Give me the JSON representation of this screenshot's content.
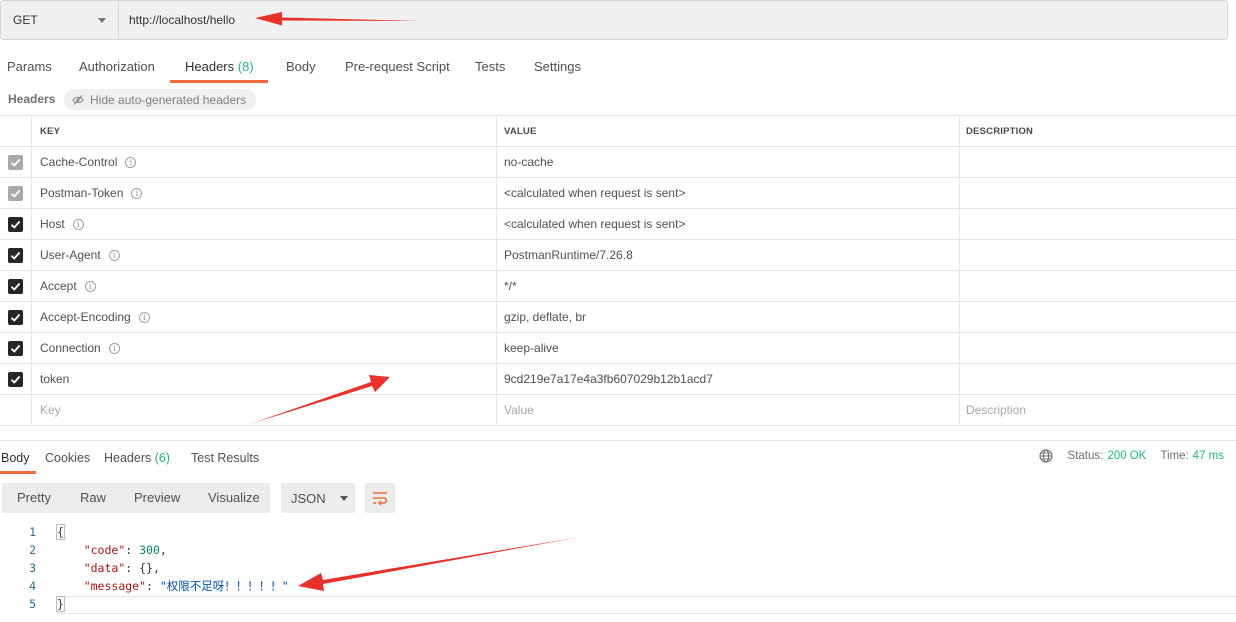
{
  "request": {
    "method": "GET",
    "url": "http://localhost/hello"
  },
  "request_tabs": [
    {
      "label": "Params",
      "count": ""
    },
    {
      "label": "Authorization",
      "count": ""
    },
    {
      "label": "Headers",
      "count": "(8)"
    },
    {
      "label": "Body",
      "count": ""
    },
    {
      "label": "Pre-request Script",
      "count": ""
    },
    {
      "label": "Tests",
      "count": ""
    },
    {
      "label": "Settings",
      "count": ""
    }
  ],
  "active_request_tab": "Headers",
  "headers_section": {
    "title": "Headers",
    "hide_button": "Hide auto-generated headers"
  },
  "headers_table": {
    "columns": {
      "key": "KEY",
      "value": "VALUE",
      "description": "DESCRIPTION"
    },
    "rows": [
      {
        "key": "Cache-Control",
        "value": "no-cache",
        "checked": "auto"
      },
      {
        "key": "Postman-Token",
        "value": "<calculated when request is sent>",
        "checked": "auto"
      },
      {
        "key": "Host",
        "value": "<calculated when request is sent>",
        "checked": "on"
      },
      {
        "key": "User-Agent",
        "value": "PostmanRuntime/7.26.8",
        "checked": "on"
      },
      {
        "key": "Accept",
        "value": "*/*",
        "checked": "on"
      },
      {
        "key": "Accept-Encoding",
        "value": "gzip, deflate, br",
        "checked": "on"
      },
      {
        "key": "Connection",
        "value": "keep-alive",
        "checked": "on"
      },
      {
        "key": "token",
        "value": "9cd219e7a17e4a3fb607029b12b1acd7",
        "checked": "on"
      }
    ],
    "placeholder": {
      "key": "Key",
      "value": "Value",
      "description": "Description"
    }
  },
  "response_tabs": [
    {
      "label": "Body",
      "count": ""
    },
    {
      "label": "Cookies",
      "count": ""
    },
    {
      "label": "Headers",
      "count": "(6)"
    },
    {
      "label": "Test Results",
      "count": ""
    }
  ],
  "active_response_tab": "Body",
  "response_status": {
    "status_label": "Status:",
    "status_value": "200 OK",
    "time_label": "Time:",
    "time_value": "47 ms"
  },
  "view_modes": [
    "Pretty",
    "Raw",
    "Preview",
    "Visualize"
  ],
  "format": "JSON",
  "response_body": {
    "line_numbers": [
      "1",
      "2",
      "3",
      "4",
      "5"
    ],
    "open_brace": "{",
    "close_brace": "}",
    "code_key": "\"code\"",
    "code_value": "300",
    "data_key": "\"data\"",
    "data_value": "{}",
    "message_key": "\"message\"",
    "message_value": "\"权限不足呀！！！！！\""
  },
  "colors": {
    "accent": "#f26b3a",
    "success": "#26b47f",
    "arrow": "#e8312a"
  },
  "icons": [
    "chevron-down-icon",
    "eye-slash-icon",
    "info-icon",
    "check-icon",
    "globe-icon",
    "wrap-lines-icon"
  ]
}
